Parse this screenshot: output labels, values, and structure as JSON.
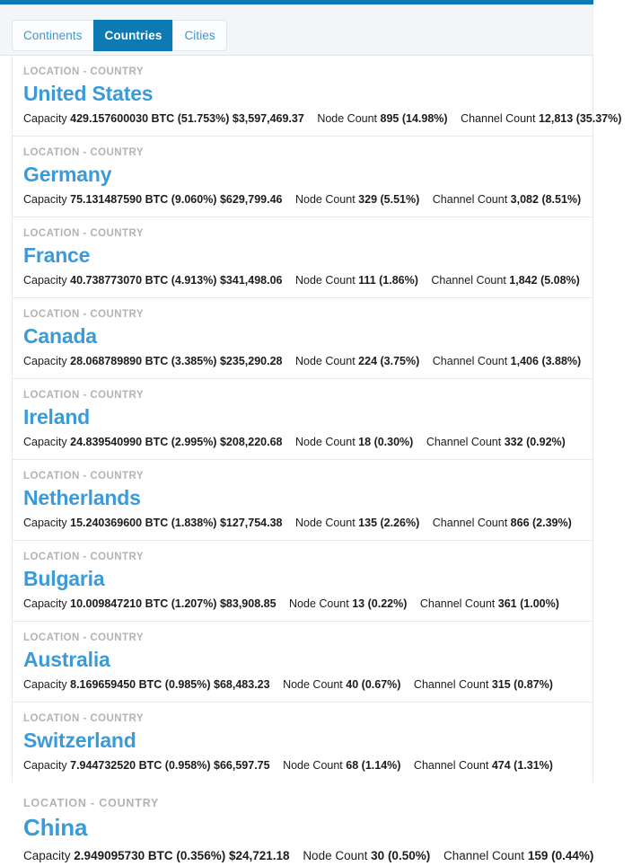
{
  "theme": {
    "accent": "#0e7ab4",
    "link": "#3b9ad8",
    "kicker": "#b3b3b3",
    "panel_bg": "#f3f6f9",
    "border": "#e6eaee"
  },
  "tabs": [
    {
      "label": "Continents",
      "active": false
    },
    {
      "label": "Countries",
      "active": true
    },
    {
      "label": "Cities",
      "active": false
    }
  ],
  "labels": {
    "kicker": "LOCATION - COUNTRY",
    "capacity": "Capacity",
    "node_count": "Node Count",
    "channel_count": "Channel Count",
    "btc_suffix": "BTC"
  },
  "rows": [
    {
      "name": "United States",
      "capacity_btc": "429.157600030",
      "capacity_pct": "(51.753%)",
      "capacity_usd": "$3,597,469.37",
      "node_count": "895",
      "node_pct": "(14.98%)",
      "channel_count": "12,813",
      "channel_pct": "(35.37%)"
    },
    {
      "name": "Germany",
      "capacity_btc": "75.131487590",
      "capacity_pct": "(9.060%)",
      "capacity_usd": "$629,799.46",
      "node_count": "329",
      "node_pct": "(5.51%)",
      "channel_count": "3,082",
      "channel_pct": "(8.51%)"
    },
    {
      "name": "France",
      "capacity_btc": "40.738773070",
      "capacity_pct": "(4.913%)",
      "capacity_usd": "$341,498.06",
      "node_count": "111",
      "node_pct": "(1.86%)",
      "channel_count": "1,842",
      "channel_pct": "(5.08%)"
    },
    {
      "name": "Canada",
      "capacity_btc": "28.068789890",
      "capacity_pct": "(3.385%)",
      "capacity_usd": "$235,290.28",
      "node_count": "224",
      "node_pct": "(3.75%)",
      "channel_count": "1,406",
      "channel_pct": "(3.88%)"
    },
    {
      "name": "Ireland",
      "capacity_btc": "24.839540990",
      "capacity_pct": "(2.995%)",
      "capacity_usd": "$208,220.68",
      "node_count": "18",
      "node_pct": "(0.30%)",
      "channel_count": "332",
      "channel_pct": "(0.92%)"
    },
    {
      "name": "Netherlands",
      "capacity_btc": "15.240369600",
      "capacity_pct": "(1.838%)",
      "capacity_usd": "$127,754.38",
      "node_count": "135",
      "node_pct": "(2.26%)",
      "channel_count": "866",
      "channel_pct": "(2.39%)"
    },
    {
      "name": "Bulgaria",
      "capacity_btc": "10.009847210",
      "capacity_pct": "(1.207%)",
      "capacity_usd": "$83,908.85",
      "node_count": "13",
      "node_pct": "(0.22%)",
      "channel_count": "361",
      "channel_pct": "(1.00%)"
    },
    {
      "name": "Australia",
      "capacity_btc": "8.169659450",
      "capacity_pct": "(0.985%)",
      "capacity_usd": "$68,483.23",
      "node_count": "40",
      "node_pct": "(0.67%)",
      "channel_count": "315",
      "channel_pct": "(0.87%)"
    },
    {
      "name": "Switzerland",
      "capacity_btc": "7.944732520",
      "capacity_pct": "(0.958%)",
      "capacity_usd": "$66,597.75",
      "node_count": "68",
      "node_pct": "(1.14%)",
      "channel_count": "474",
      "channel_pct": "(1.31%)"
    }
  ],
  "last_row": {
    "name": "China",
    "capacity_btc": "2.949095730",
    "capacity_pct": "(0.356%)",
    "capacity_usd": "$24,721.18",
    "node_count": "30",
    "node_pct": "(0.50%)",
    "channel_count": "159",
    "channel_pct": "(0.44%)"
  }
}
